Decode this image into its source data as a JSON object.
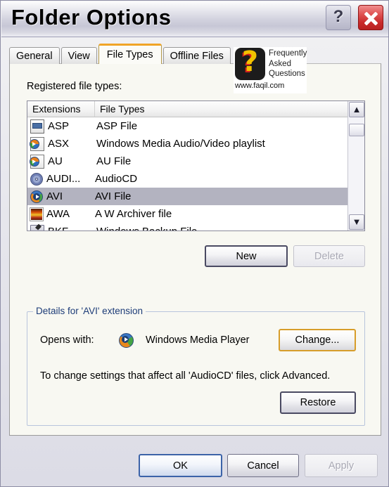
{
  "window": {
    "title": "Folder Options",
    "help_label": "?",
    "close_label": "close-x"
  },
  "tabs": [
    {
      "label": "General",
      "active": false
    },
    {
      "label": "View",
      "active": false
    },
    {
      "label": "File Types",
      "active": true
    },
    {
      "label": "Offline Files",
      "active": false
    }
  ],
  "watermark": {
    "line1": "Frequently",
    "line2": "Asked",
    "line3": "Questions",
    "url": "www.faqil.com",
    "logo_glyph": "?"
  },
  "main": {
    "registered_label": "Registered file types:",
    "columns": [
      "Extensions",
      "File Types"
    ],
    "rows": [
      {
        "ext": "ASP",
        "type": "ASP File",
        "icon": "asp-page-icon",
        "selected": false
      },
      {
        "ext": "ASX",
        "type": "Windows Media Audio/Video playlist",
        "icon": "media-playlist-icon",
        "selected": false
      },
      {
        "ext": "AU",
        "type": "AU File",
        "icon": "media-playlist-icon",
        "selected": false
      },
      {
        "ext": "AUDI...",
        "type": "AudioCD",
        "icon": "audio-cd-icon",
        "selected": false
      },
      {
        "ext": "AVI",
        "type": "AVI File",
        "icon": "windows-media-player-icon",
        "selected": true
      },
      {
        "ext": "AWA",
        "type": "A W Archiver file",
        "icon": "photo-archive-icon",
        "selected": false
      },
      {
        "ext": "BKF",
        "type": "Windows Backup File",
        "icon": "backup-file-icon",
        "selected": false
      }
    ],
    "new_button": "New",
    "delete_button": "Delete"
  },
  "details": {
    "legend": "Details for 'AVI' extension",
    "opens_with_label": "Opens with:",
    "opens_with_value": "Windows Media Player",
    "opens_with_icon": "windows-media-player-icon",
    "change_button": "Change...",
    "advanced_note": "To change settings that affect all 'AudioCD' files, click Advanced.",
    "restore_button": "Restore"
  },
  "footer": {
    "ok_button": "OK",
    "cancel_button": "Cancel",
    "apply_button": "Apply"
  },
  "colors": {
    "accent_orange": "#f0a427",
    "default_blue": "#3c63a8",
    "selection": "#b3b3c0",
    "legend_blue": "#1d3c78",
    "close_red": "#c92b2b"
  }
}
